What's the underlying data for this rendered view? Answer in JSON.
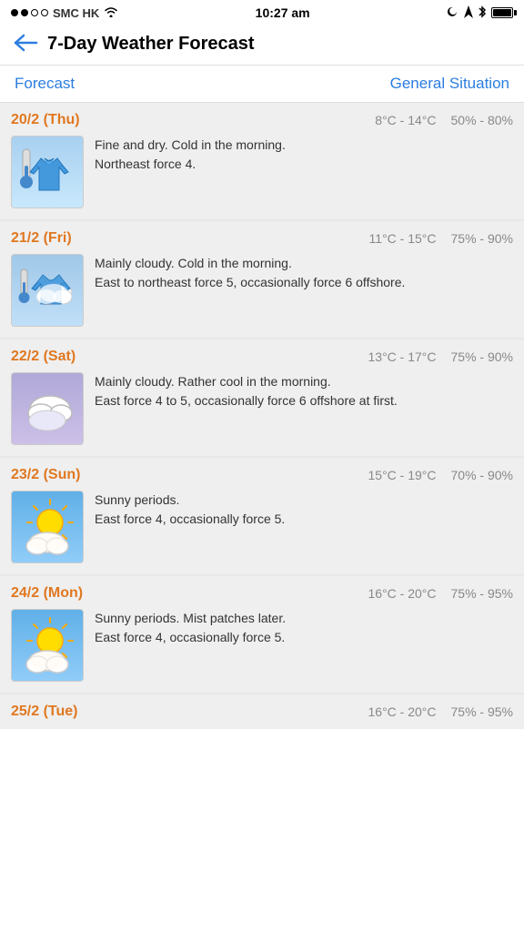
{
  "statusBar": {
    "carrier": "SMC HK",
    "time": "10:27 am",
    "signalFull": 2,
    "signalEmpty": 2
  },
  "header": {
    "title": "7-Day Weather Forecast",
    "backLabel": "Back"
  },
  "tabs": [
    {
      "id": "forecast",
      "label": "Forecast",
      "active": true
    },
    {
      "id": "general",
      "label": "General Situation",
      "active": false
    }
  ],
  "forecasts": [
    {
      "id": "day1",
      "date": "20/2 (Thu)",
      "tempRange": "8°C - 14°C",
      "humidityRange": "50% - 80%",
      "description": "Fine and dry. Cold in the morning.\nNortheast force 4.",
      "iconType": "cold-sweater"
    },
    {
      "id": "day2",
      "date": "21/2 (Fri)",
      "tempRange": "11°C - 15°C",
      "humidityRange": "75% - 90%",
      "description": "Mainly cloudy. Cold in the morning.\nEast to northeast force 5, occasionally force 6 offshore.",
      "iconType": "cold-cloudy"
    },
    {
      "id": "day3",
      "date": "22/2 (Sat)",
      "tempRange": "13°C - 17°C",
      "humidityRange": "75% - 90%",
      "description": "Mainly cloudy. Rather cool in the morning.\nEast force 4 to 5, occasionally force 6 offshore at first.",
      "iconType": "cloudy"
    },
    {
      "id": "day4",
      "date": "23/2 (Sun)",
      "tempRange": "15°C - 19°C",
      "humidityRange": "70% - 90%",
      "description": "Sunny periods.\nEast force 4, occasionally force 5.",
      "iconType": "sunny-periods"
    },
    {
      "id": "day5",
      "date": "24/2 (Mon)",
      "tempRange": "16°C - 20°C",
      "humidityRange": "75% - 95%",
      "description": "Sunny periods. Mist patches later.\nEast force 4, occasionally force 5.",
      "iconType": "sunny-periods"
    },
    {
      "id": "day6",
      "date": "25/2 (Tue)",
      "tempRange": "16°C - 20°C",
      "humidityRange": "75% - 95%",
      "description": "",
      "iconType": "sunny-periods"
    }
  ],
  "colors": {
    "accent": "#2b7ddf",
    "dateColor": "#e07820",
    "statsColor": "#888888",
    "descColor": "#333333"
  }
}
